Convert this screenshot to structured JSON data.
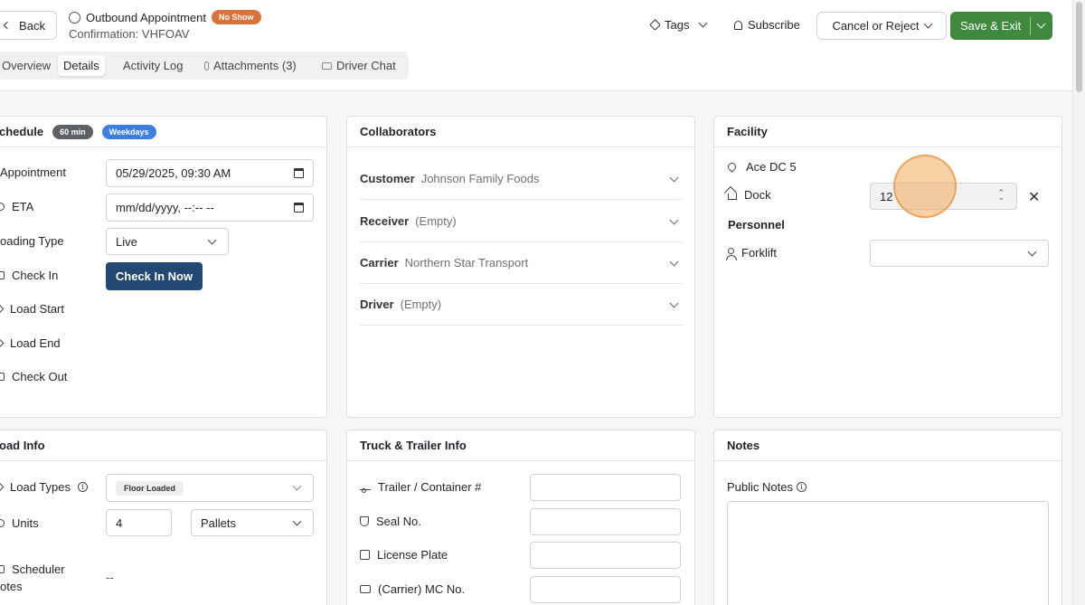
{
  "header": {
    "back_label": "Back",
    "appointment_title": "Outbound Appointment",
    "status_badge": "No Show",
    "confirmation": "Confirmation: VHFOAV",
    "tags_label": "Tags",
    "subscribe_label": "Subscribe",
    "cancel_label": "Cancel or Reject",
    "save_label": "Save & Exit"
  },
  "tabs": [
    {
      "label": "Overview"
    },
    {
      "label": "Details"
    },
    {
      "label": "Activity Log"
    },
    {
      "label": "Attachments (3)"
    },
    {
      "label": "Driver Chat"
    }
  ],
  "schedule": {
    "title": "chedule",
    "duration_badge": "60 min",
    "days_badge": "Weekdays",
    "appointment_label": "Appointment",
    "appointment_value": "05/29/2025, 09:30  AM",
    "eta_label": "ETA",
    "eta_value": "mm/dd/yyyy, --:-- --",
    "loading_type_label": "oading Type",
    "loading_type_value": "Live",
    "check_in_label": "Check In",
    "check_in_button": "Check In Now",
    "load_start_label": "Load Start",
    "load_end_label": "Load End",
    "check_out_label": "Check Out"
  },
  "collaborators": {
    "title": "Collaborators",
    "rows": [
      {
        "key": "Customer",
        "value": "Johnson Family Foods"
      },
      {
        "key": "Receiver",
        "value": "(Empty)"
      },
      {
        "key": "Carrier",
        "value": "Northern Star Transport"
      },
      {
        "key": "Driver",
        "value": "(Empty)"
      }
    ]
  },
  "facility": {
    "title": "Facility",
    "location": "Ace DC 5",
    "dock_label": "Dock",
    "dock_value": "12",
    "personnel_title": "Personnel",
    "forklift_label": "Forklift",
    "forklift_value": ""
  },
  "load_info": {
    "title": "oad Info",
    "load_types_label": "Load Types",
    "load_types_chip": "Floor Loaded",
    "units_label": "Units",
    "units_value": "4",
    "units_type": "Pallets",
    "scheduler_notes_label_1": "Scheduler",
    "scheduler_notes_label_2": "otes",
    "scheduler_notes_value": "--"
  },
  "truck_trailer": {
    "title": "Truck & Trailer Info",
    "trailer_label": "Trailer / Container #",
    "seal_label": "Seal No.",
    "license_label": "License Plate",
    "mc_label": "(Carrier) MC No."
  },
  "notes": {
    "title": "Notes",
    "public_notes_label": "Public Notes"
  }
}
